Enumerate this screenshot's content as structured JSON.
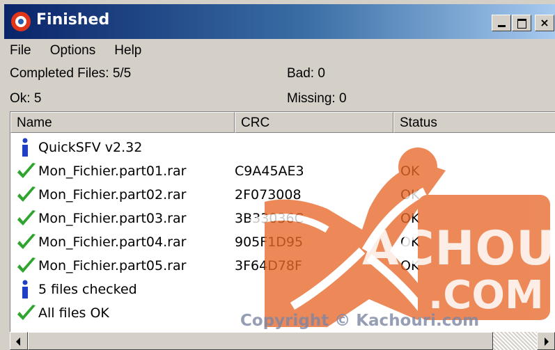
{
  "window": {
    "title": "Finished",
    "controls": [
      "minimize-icon",
      "maximize-icon",
      "close-icon"
    ],
    "close_glyph": "×"
  },
  "menu": {
    "items": [
      {
        "label": "File"
      },
      {
        "label": "Options"
      },
      {
        "label": "Help"
      }
    ]
  },
  "stats": {
    "completed": "Completed Files: 5/5",
    "bad": "Bad: 0",
    "ok": "Ok: 5",
    "missing": "Missing: 0"
  },
  "list": {
    "columns": {
      "name": "Name",
      "crc": "CRC",
      "status": "Status"
    },
    "rows": [
      {
        "icon": "info-icon",
        "name": "QuickSFV v2.32",
        "crc": "",
        "status": ""
      },
      {
        "icon": "checkmark-icon",
        "name": "Mon_Fichier.part01.rar",
        "crc": "C9A45AE3",
        "status": "OK"
      },
      {
        "icon": "checkmark-icon",
        "name": "Mon_Fichier.part02.rar",
        "crc": "2F073008",
        "status": "OK"
      },
      {
        "icon": "checkmark-icon",
        "name": "Mon_Fichier.part03.rar",
        "crc": "3B33036C",
        "status": "OK"
      },
      {
        "icon": "checkmark-icon",
        "name": "Mon_Fichier.part04.rar",
        "crc": "905F1D95",
        "status": "OK"
      },
      {
        "icon": "checkmark-icon",
        "name": "Mon_Fichier.part05.rar",
        "crc": "3F64D78F",
        "status": "OK"
      },
      {
        "icon": "info-icon",
        "name": "5 files checked",
        "crc": "",
        "status": ""
      },
      {
        "icon": "checkmark-icon",
        "name": "All files OK",
        "crc": "",
        "status": ""
      }
    ]
  },
  "watermark": {
    "brand": "ACHOURI",
    "domain": ".COM",
    "copyright": "Copyright © Kachouri.com",
    "color": "#e8692a"
  },
  "colors": {
    "title_gradient_start": "#0a246a",
    "title_gradient_end": "#a6caf0",
    "check_green": "#2fa52f",
    "info_blue": "#1f3fc7"
  }
}
